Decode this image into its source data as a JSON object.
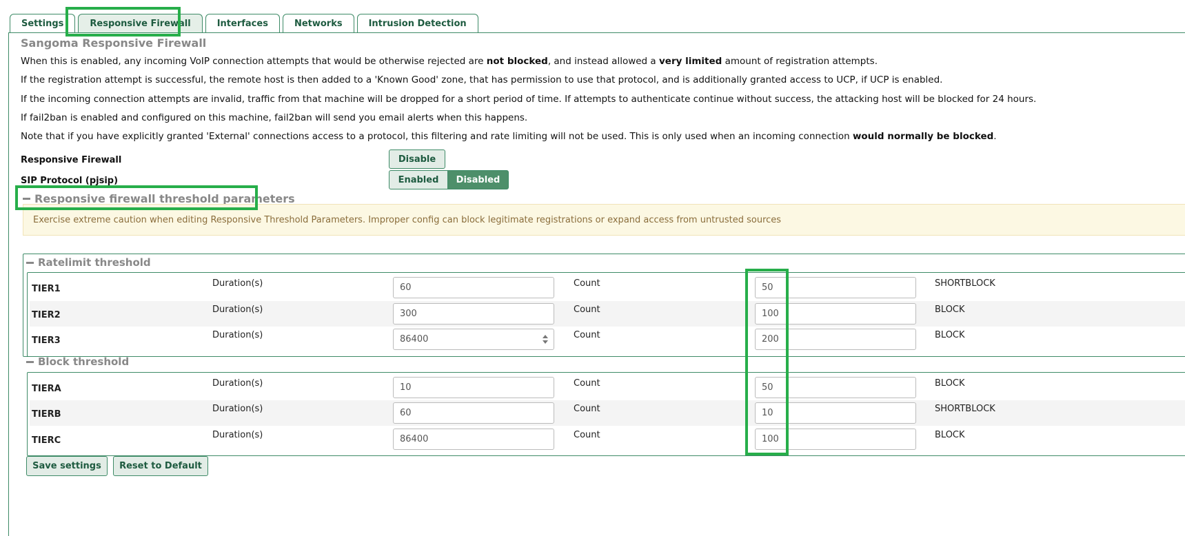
{
  "tabs": [
    "Settings",
    "Responsive Firewall",
    "Interfaces",
    "Networks",
    "Intrusion Detection"
  ],
  "title": "Sangoma Responsive Firewall",
  "paras": {
    "p1a": "When this is enabled, any incoming VoIP connection attempts that would be otherwise rejected are ",
    "p1b": "not blocked",
    "p1c": ", and instead allowed a ",
    "p1d": "very limited",
    "p1e": " amount of registration attempts.",
    "p2": "If the registration attempt is successful, the remote host is then added to a 'Known Good' zone, that has permission to use that protocol, and is additionally granted access to UCP, if UCP is enabled.",
    "p3": "If the incoming connection attempts are invalid, traffic from that machine will be dropped for a short period of time. If attempts to authenticate continue without success, the attacking host will be blocked for 24 hours.",
    "p4": "If fail2ban is enabled and configured on this machine, fail2ban will send you email alerts when this happens.",
    "p5a": "Note that if you have explicitly granted 'External' connections access to a protocol, this filtering and rate limiting will not be used. This is only used when an incoming connection ",
    "p5b": "would normally be blocked",
    "p5c": "."
  },
  "responsive_firewall": {
    "label": "Responsive Firewall",
    "button": "Disable"
  },
  "sip": {
    "label": "SIP Protocol (pjsip)",
    "enabled": "Enabled",
    "disabled": "Disabled"
  },
  "threshold_header": "Responsive firewall threshold parameters",
  "warning": "Exercise extreme caution when editing Responsive Threshold Parameters. Improper config can block legitimate registrations or expand access from untrusted sources",
  "ratelimit": {
    "header": "Ratelimit threshold",
    "rows": [
      {
        "tier": "TIER1",
        "dlabel": "Duration(s)",
        "duration": "60",
        "clabel": "Count",
        "count": "50",
        "action": "SHORTBLOCK"
      },
      {
        "tier": "TIER2",
        "dlabel": "Duration(s)",
        "duration": "300",
        "clabel": "Count",
        "count": "100",
        "action": "BLOCK"
      },
      {
        "tier": "TIER3",
        "dlabel": "Duration(s)",
        "duration": "86400",
        "clabel": "Count",
        "count": "200",
        "action": "BLOCK"
      }
    ]
  },
  "block": {
    "header": "Block threshold",
    "rows": [
      {
        "tier": "TIERA",
        "dlabel": "Duration(s)",
        "duration": "10",
        "clabel": "Count",
        "count": "50",
        "action": "BLOCK"
      },
      {
        "tier": "TIERB",
        "dlabel": "Duration(s)",
        "duration": "60",
        "clabel": "Count",
        "count": "10",
        "action": "SHORTBLOCK"
      },
      {
        "tier": "TIERC",
        "dlabel": "Duration(s)",
        "duration": "86400",
        "clabel": "Count",
        "count": "100",
        "action": "BLOCK"
      }
    ]
  },
  "buttons": {
    "save": "Save settings",
    "reset": "Reset to Default"
  },
  "colors": {
    "accent": "#3d8a66",
    "highlight": "#27ae4a",
    "warning_bg": "#fcf8e3"
  }
}
